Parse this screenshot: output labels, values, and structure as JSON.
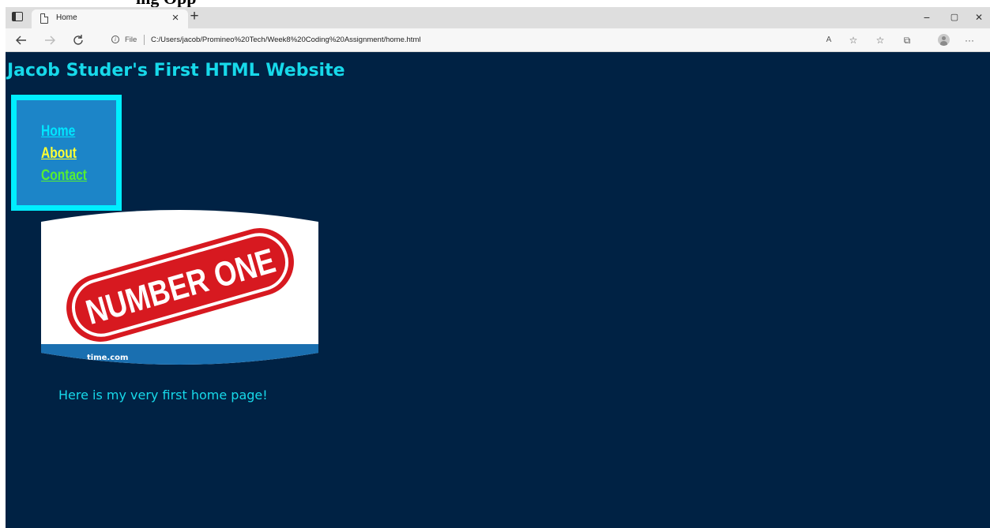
{
  "document": {
    "heading": "ing Opp"
  },
  "browser": {
    "tab": {
      "title": "Home",
      "close_glyph": "×"
    },
    "new_tab_glyph": "+",
    "window_controls": {
      "minimize": "−",
      "restore": "▢",
      "close": "✕"
    },
    "address": {
      "info_glyph": "i",
      "file_label": "File",
      "url": "C:/Users/jacob/Promineo%20Tech/Week8%20Coding%20Assignment/home.html"
    },
    "toolbar": {
      "read_aloud": "A",
      "favorite_add": "☆",
      "favorites": "☆",
      "collections": "⧉",
      "more": "···"
    },
    "icons": [
      "tab-actions-icon",
      "page-icon",
      "info-icon",
      "back-arrow-icon",
      "forward-arrow-icon",
      "refresh-icon",
      "read-aloud-icon",
      "add-favorite-icon",
      "favorites-icon",
      "collections-icon",
      "profile-icon",
      "more-icon"
    ]
  },
  "page": {
    "site_title": "Jacob Studer's First HTML Website",
    "nav": [
      {
        "label": "Home",
        "color": "#00e5ff"
      },
      {
        "label": "About",
        "color": "#ffff33"
      },
      {
        "label": "Contact",
        "color": "#55ee33"
      }
    ],
    "hero": {
      "stamp_text": "NUMBER ONE",
      "watermark_text": "time.com"
    },
    "tagline": "Here is my very first home page!"
  },
  "colors": {
    "page_background": "#002244",
    "title_color": "#17d9ea",
    "nav_border": "#00eeff",
    "nav_background": "#1c85c8",
    "stamp_red": "#d71920"
  }
}
